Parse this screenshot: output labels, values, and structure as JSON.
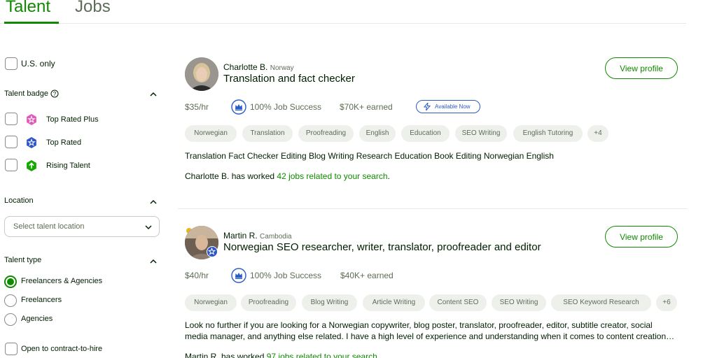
{
  "tabs": [
    {
      "label": "Talent",
      "active": true
    },
    {
      "label": "Jobs",
      "active": false
    }
  ],
  "sidebar": {
    "us_only": "U.S. only",
    "talent_badge_title": "Talent badge",
    "badges": [
      {
        "label": "Top Rated Plus",
        "icon": "star-pink-icon",
        "color": "#e25ab8"
      },
      {
        "label": "Top Rated",
        "icon": "star-blue-icon",
        "color": "#2f56c7"
      },
      {
        "label": "Rising Talent",
        "icon": "arrow-up-green-icon",
        "color": "#14a800"
      }
    ],
    "location_title": "Location",
    "location_placeholder": "Select talent location",
    "talent_type_title": "Talent type",
    "talent_types": [
      {
        "label": "Freelancers & Agencies",
        "selected": true
      },
      {
        "label": "Freelancers",
        "selected": false
      },
      {
        "label": "Agencies",
        "selected": false
      }
    ],
    "contract_to_hire": "Open to contract-to-hire"
  },
  "results": [
    {
      "name": "Charlotte B.",
      "country": "Norway",
      "title": "Translation and fact checker",
      "view_label": "View profile",
      "rate": "$35/hr",
      "job_success": "100% Job Success",
      "earned": "$70K+ earned",
      "available": "Available Now",
      "skills": [
        "Norwegian",
        "Translation",
        "Proofreading",
        "English",
        "Education",
        "SEO Writing",
        "English Tutoring",
        "+4"
      ],
      "description": "Translation Fact Checker Editing Blog Writing Research Education Book Editing Norwegian English",
      "worked_prefix": "Charlotte B. has worked ",
      "worked_link": "42 jobs related to your search",
      "worked_suffix": "."
    },
    {
      "name": "Martin R.",
      "country": "Cambodia",
      "title": "Norwegian SEO researcher, writer, translator, proofreader and editor",
      "view_label": "View profile",
      "rate": "$40/hr",
      "job_success": "100% Job Success",
      "earned": "$40K+ earned",
      "skills": [
        "Norwegian",
        "Proofreading",
        "Blog Writing",
        "Article Writing",
        "Content SEO",
        "SEO Writing",
        "SEO Keyword Research",
        "+6"
      ],
      "description": "Look no further if you are looking for a Norwegian copywriter, blog poster, translator, proofreader, editor, subtitle creator, social media manager, and anything else related. I have a high level of experience and understanding when it comes to content creation…",
      "worked_prefix": "Martin R. has worked ",
      "worked_link": "97 jobs related to your search",
      "worked_suffix": "."
    }
  ],
  "colors": {
    "brand_green": "#108a00",
    "available_blue": "#2a5cc3"
  }
}
